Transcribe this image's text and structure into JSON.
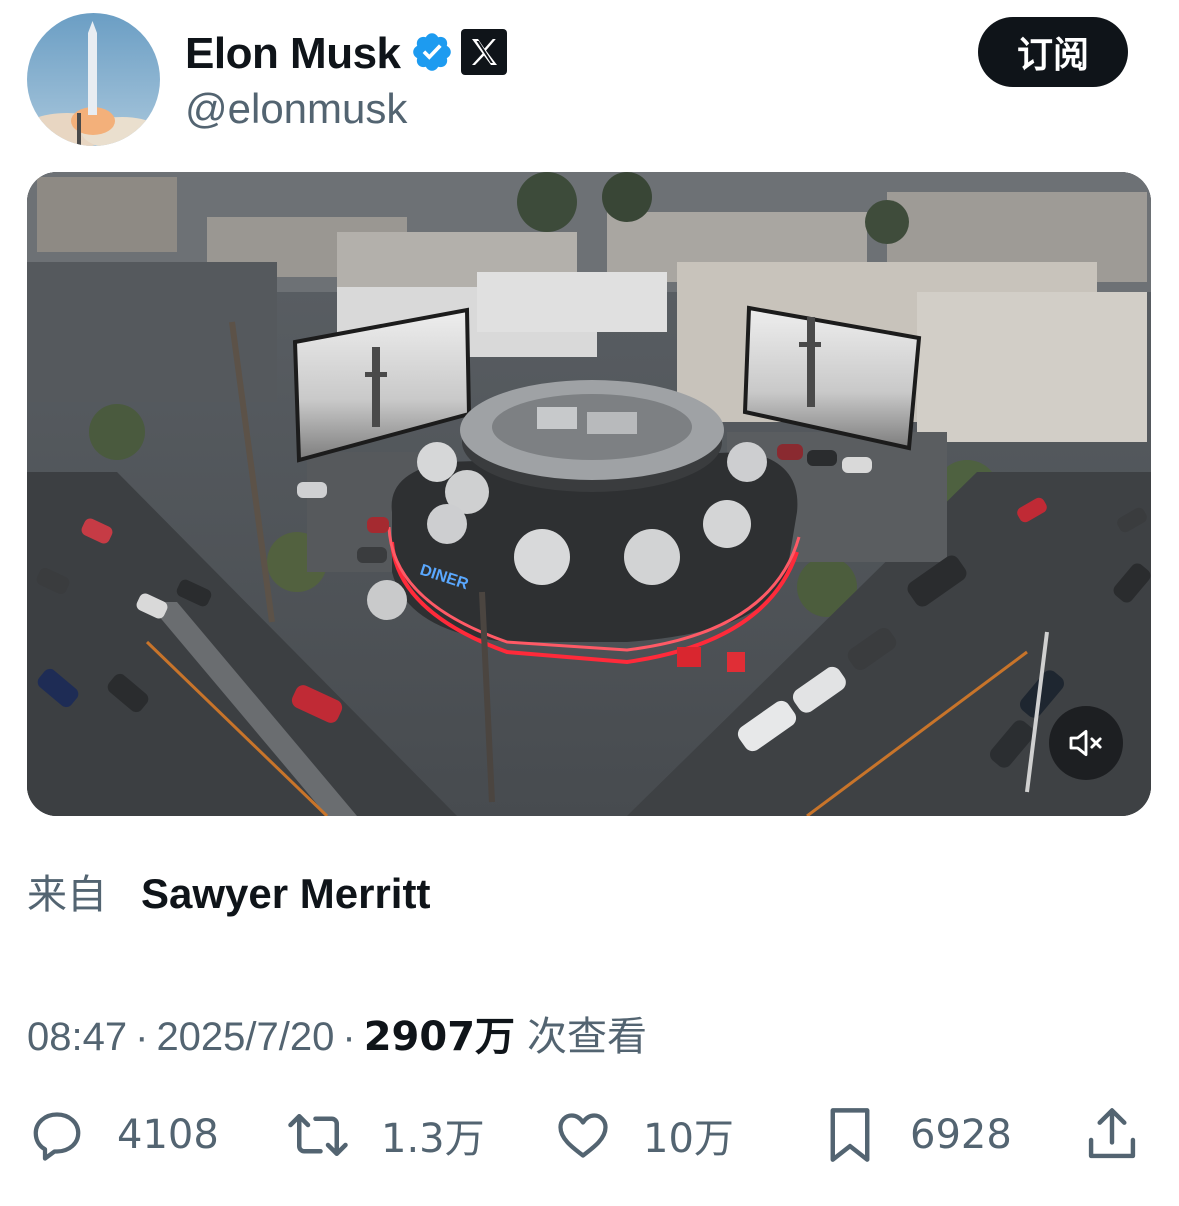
{
  "author": {
    "name": "Elon Musk",
    "handle": "@elonmusk"
  },
  "header": {
    "subscribe_label": "订阅"
  },
  "media": {
    "type": "video",
    "muted": true
  },
  "source": {
    "prefix": "来自",
    "name": "Sawyer Merritt"
  },
  "meta": {
    "time": "08:47",
    "separator": "·",
    "date": "2025/7/20",
    "views_count": "2907万",
    "views_label": "次查看"
  },
  "actions": {
    "reply": "4108",
    "repost": "1.3万",
    "like": "10万",
    "bookmark": "6928"
  },
  "icons": {
    "verified": "verified-badge-icon",
    "x_logo": "x-logo-icon",
    "mute": "speaker-muted-icon",
    "reply": "reply-bubble-icon",
    "repost": "repost-arrows-icon",
    "like": "heart-icon",
    "bookmark": "bookmark-icon",
    "share": "share-upload-icon"
  },
  "colors": {
    "text_primary": "#0f1419",
    "text_secondary": "#536471",
    "verified_blue": "#1d9bf0",
    "neon_red": "#ff2a3a"
  }
}
